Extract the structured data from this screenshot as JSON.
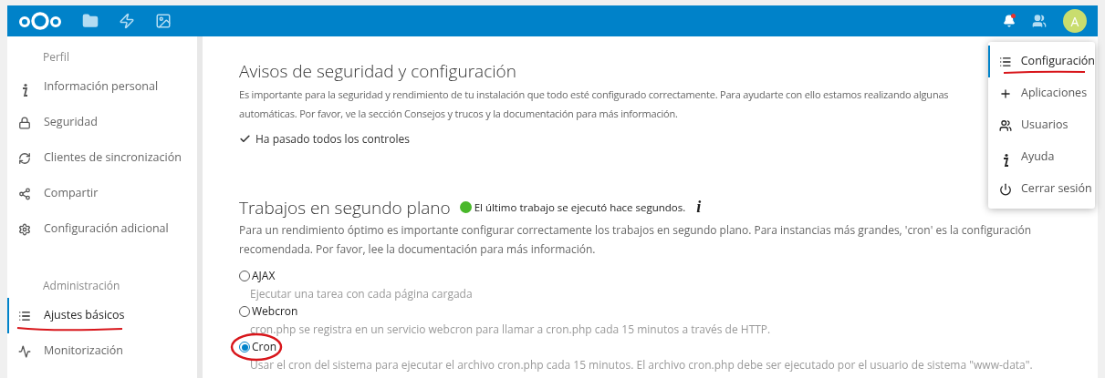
{
  "topbar": {
    "apps": [
      {
        "kind": "files"
      },
      {
        "kind": "activity"
      },
      {
        "kind": "gallery"
      }
    ],
    "avatar": "A"
  },
  "sidebar": {
    "sections": [
      {
        "title": "Perfil",
        "items": [
          {
            "label": "Información personal",
            "selected": false
          },
          {
            "label": "Seguridad",
            "selected": false
          },
          {
            "label": "Clientes de sincronización",
            "selected": false
          },
          {
            "label": "Compartir",
            "selected": false
          },
          {
            "label": "Configuración adicional",
            "selected": false
          }
        ]
      },
      {
        "title": "Administración",
        "items": [
          {
            "label": "Ajustes básicos",
            "selected": true
          },
          {
            "label": "Monitorización",
            "selected": false
          }
        ]
      }
    ]
  },
  "security": {
    "title": "Avisos de seguridad y configuración",
    "lines": [
      "Es importante para la seguridad y rendimiento de tu instalación que todo esté configurado correctamente. Para ayudarte con ello estamos realizando algunas",
      "automáticas. Por favor, ve la sección Consejos y trucos y la documentación para más información."
    ],
    "status": "Ha pasado todos los controles"
  },
  "background_jobs": {
    "title": "Trabajos en segundo plano",
    "status": "El último trabajo se ejecutó hace segundos.",
    "info": "i",
    "description": "Para un rendimiento óptimo es importante configurar correctamente los trabajos en segundo plano. Para instancias más grandes, 'cron' es la configuración recomendada. Por favor, lee la documentación para más información.",
    "options": [
      {
        "label": "AJAX",
        "hint": "Ejecutar una tarea con cada página cargada",
        "selected": false
      },
      {
        "label": "Webcron",
        "hint": "cron.php se registra en un servicio webcron para llamar a cron.php cada 15 minutos a través de HTTP.",
        "selected": false
      },
      {
        "label": "Cron",
        "hint": "Usar el cron del sistema para ejecutar el archivo cron.php cada 15 minutos. El archivo cron.php debe ser ejecutado por el usuario de sistema \"www-data\".",
        "selected": true
      }
    ]
  },
  "user_menu": {
    "items": [
      {
        "label": "Configuración",
        "selected": true
      },
      {
        "label": "Aplicaciones",
        "selected": false
      },
      {
        "label": "Usuarios",
        "selected": false
      },
      {
        "label": "Ayuda",
        "selected": false
      },
      {
        "label": "Cerrar sesión",
        "selected": false
      }
    ]
  }
}
